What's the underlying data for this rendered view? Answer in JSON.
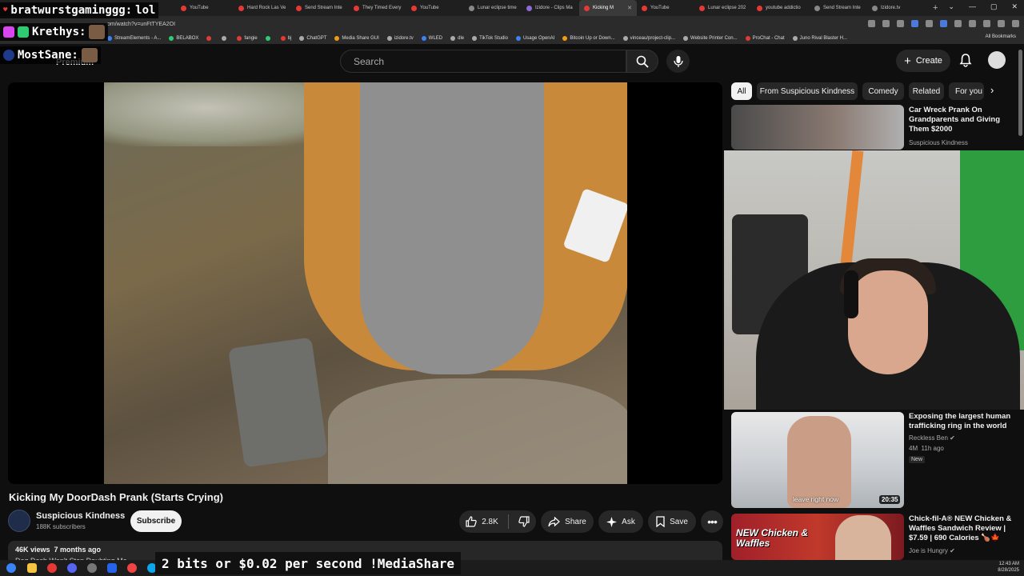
{
  "browser": {
    "tabs": [
      {
        "label": "YouTube",
        "fav": "red"
      },
      {
        "label": "Hard Rock Las Ve",
        "fav": "red"
      },
      {
        "label": "Send Stream Inte",
        "fav": "red"
      },
      {
        "label": "They Timed Every",
        "fav": "red"
      },
      {
        "label": "YouTube",
        "fav": "red"
      },
      {
        "label": "Lunar eclipse time",
        "fav": "gray"
      },
      {
        "label": "Izidore - Clips Ma",
        "fav": "purple"
      },
      {
        "label": "Kicking M",
        "fav": "red",
        "active": true
      },
      {
        "label": "YouTube",
        "fav": "red"
      },
      {
        "label": "Lunar eclipse 202",
        "fav": "red"
      },
      {
        "label": "youtube addictio",
        "fav": "red"
      },
      {
        "label": "Send Stream Inte",
        "fav": "gray"
      },
      {
        "label": "Izidore.tv",
        "fav": "gray"
      }
    ],
    "new_tab": "+",
    "window_controls": [
      "⌄",
      "—",
      "▢",
      "✕"
    ],
    "url": "om/watch?v=unFtTYEA2OI",
    "bookmarks": [
      {
        "label": "StreamElements - A...",
        "c": "b"
      },
      {
        "label": "BELABOX",
        "c": "g"
      },
      {
        "label": "",
        "c": "r"
      },
      {
        "label": "",
        "c": ""
      },
      {
        "label": "fangie",
        "c": "r"
      },
      {
        "label": "",
        "c": "g"
      },
      {
        "label": "bj",
        "c": "r"
      },
      {
        "label": "ChatGPT",
        "c": ""
      },
      {
        "label": "Media Share GUI",
        "c": "o"
      },
      {
        "label": "izidore.tv",
        "c": ""
      },
      {
        "label": "WLED",
        "c": "b"
      },
      {
        "label": "dle",
        "c": ""
      },
      {
        "label": "TikTok Studio",
        "c": ""
      },
      {
        "label": "Usage OpenAI",
        "c": "b"
      },
      {
        "label": "Bitcoin Up or Down...",
        "c": "o"
      },
      {
        "label": "vinceau/project-clip...",
        "c": ""
      },
      {
        "label": "Website Printer Con...",
        "c": ""
      },
      {
        "label": "ProChat - Chat",
        "c": "r"
      },
      {
        "label": "Juno Rival Blaster H...",
        "c": ""
      }
    ],
    "all_bookmarks": "All Bookmarks"
  },
  "chat_overlay": [
    {
      "user": "bratwurstgaminggg:",
      "msg": "lol"
    },
    {
      "user": "Krethys:",
      "msg": ""
    },
    {
      "user": "MostSane:",
      "msg": ""
    }
  ],
  "youtube": {
    "logo_fragment": "Premium",
    "search_placeholder": "Search",
    "create_label": "Create"
  },
  "video": {
    "title": "Kicking My DoorDash Prank (Starts Crying)",
    "channel": "Suspicious Kindness",
    "subscribers": "188K subscribers",
    "subscribe_label": "Subscribe",
    "likes": "2.8K",
    "share_label": "Share",
    "ask_label": "Ask",
    "save_label": "Save",
    "views_time": "46K views  7 months ago",
    "desc_fragment": "Dog Dash Won't Stop Doubting Me"
  },
  "chips": [
    "All",
    "From Suspicious Kindness",
    "Comedy",
    "Related",
    "For you"
  ],
  "recommendations": [
    {
      "title": "Car Wreck Prank On Grandparents and Giving Them $2000",
      "channel": "Suspicious Kindness",
      "meta": "",
      "duration": "",
      "new": ""
    },
    {
      "title": "Exposing the largest human trafficking ring in the world",
      "channel": "Reckless Ben ✔",
      "meta": "4M  11h ago",
      "duration": "20:35",
      "new": "New",
      "overlay": "leave right now"
    },
    {
      "title": "Chick-fil-A® NEW Chicken & Waffles Sandwich Review | $7.59 | 690 Calories 🍗🍁",
      "channel": "Joe is Hungry ✔",
      "meta": "",
      "duration": "",
      "new": "",
      "overlay_text": "NEW Chicken & Waffles"
    }
  ],
  "mediashare_banner": "2 bits or $0.02 per second !MediaShare",
  "taskbar": {
    "time": "12:43 AM",
    "date": "8/28/2025"
  }
}
